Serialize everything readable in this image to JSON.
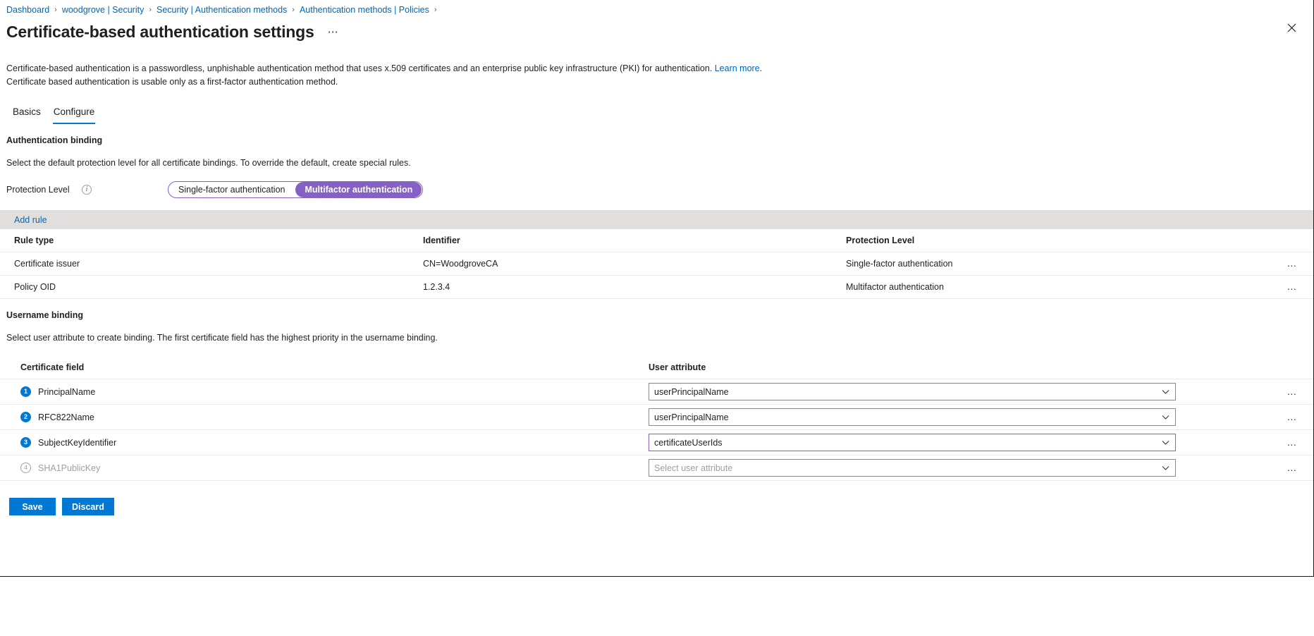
{
  "breadcrumb": {
    "items": [
      {
        "label": "Dashboard"
      },
      {
        "label": "woodgrove | Security"
      },
      {
        "label": "Security | Authentication methods"
      },
      {
        "label": "Authentication methods | Policies"
      }
    ],
    "separator": "›"
  },
  "header": {
    "title": "Certificate-based authentication settings",
    "ellipsis": "⋯",
    "close_icon": "close-icon"
  },
  "intro": {
    "line1_before_link": "Certificate-based authentication is a passwordless, unphishable authentication method that uses x.509 certificates and an enterprise public key infrastructure (PKI) for authentication. ",
    "link_label": "Learn more",
    "line1_after_link": ".",
    "line2": "Certificate based authentication is usable only as a first-factor authentication method."
  },
  "tabs": [
    {
      "label": "Basics",
      "active": false
    },
    {
      "label": "Configure",
      "active": true
    }
  ],
  "authentication_binding": {
    "heading": "Authentication binding",
    "description": "Select the default protection level for all certificate bindings. To override the default, create special rules.",
    "protection_level_label": "Protection Level",
    "info_glyph": "i",
    "choices": [
      {
        "label": "Single-factor authentication",
        "selected": false
      },
      {
        "label": "Multifactor authentication",
        "selected": true
      }
    ],
    "selected_color": "#8661c5"
  },
  "rules": {
    "add_rule_label": "Add rule",
    "columns": [
      "Rule type",
      "Identifier",
      "Protection Level"
    ],
    "rows": [
      {
        "rule_type": "Certificate issuer",
        "identifier": "CN=WoodgroveCA",
        "protection_level": "Single-factor authentication",
        "actions": "…"
      },
      {
        "rule_type": "Policy OID",
        "identifier": "1.2.3.4",
        "protection_level": "Multifactor authentication",
        "actions": "…"
      }
    ]
  },
  "username_binding": {
    "heading": "Username binding",
    "description": "Select user attribute to create binding. The first certificate field has the highest priority in the username binding.",
    "columns": [
      "Certificate field",
      "User attribute"
    ],
    "rows": [
      {
        "index": "1",
        "field": "PrincipalName",
        "attribute_value": "userPrincipalName",
        "attribute_placeholder": "",
        "focused": false,
        "enabled": true,
        "actions": "…"
      },
      {
        "index": "2",
        "field": "RFC822Name",
        "attribute_value": "userPrincipalName",
        "attribute_placeholder": "",
        "focused": false,
        "enabled": true,
        "actions": "…"
      },
      {
        "index": "3",
        "field": "SubjectKeyIdentifier",
        "attribute_value": "certificateUserIds",
        "attribute_placeholder": "",
        "focused": true,
        "enabled": true,
        "actions": "…"
      },
      {
        "index": "4",
        "field": "SHA1PublicKey",
        "attribute_value": "",
        "attribute_placeholder": "Select user attribute",
        "focused": false,
        "enabled": false,
        "actions": "…"
      }
    ]
  },
  "footer": {
    "save_label": "Save",
    "discard_label": "Discard"
  },
  "colors": {
    "accent": "#0078d4",
    "link": "#0067b8",
    "purple": "#8661c5",
    "command_bar": "#e1dfdd"
  }
}
